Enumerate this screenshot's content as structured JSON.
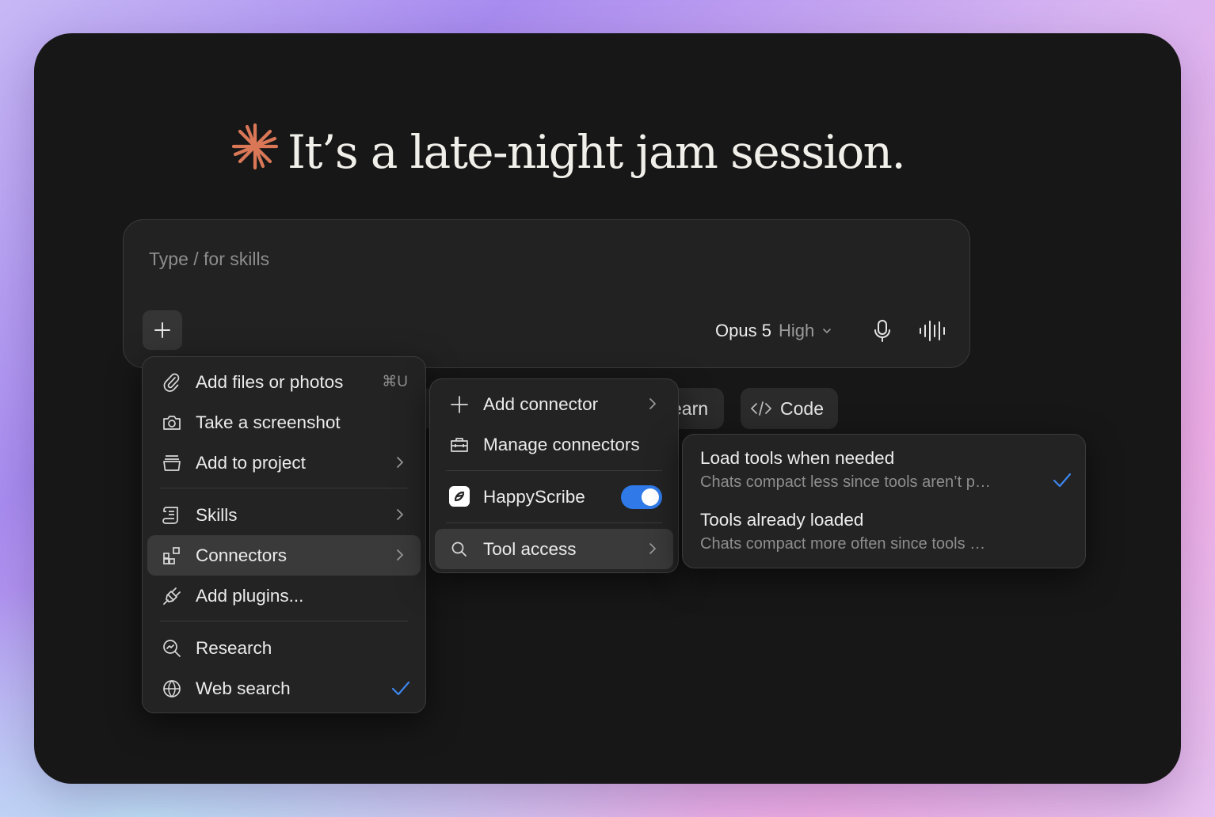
{
  "headline": {
    "text": "It’s a late-night jam session."
  },
  "composer": {
    "placeholder": "Type / for skills",
    "model_name": "Opus 5",
    "effort": "High"
  },
  "chips": {
    "learn_partial": "earn",
    "code": "Code"
  },
  "plus_menu": {
    "add_files": {
      "label": "Add files or photos",
      "shortcut": "⌘U"
    },
    "screenshot": "Take a screenshot",
    "add_project": "Add to project",
    "skills": "Skills",
    "connectors": "Connectors",
    "add_plugins": "Add plugins...",
    "research": "Research",
    "web_search": "Web search"
  },
  "connectors_menu": {
    "add_connector": "Add connector",
    "manage": "Manage connectors",
    "happyscribe": {
      "label": "HappyScribe",
      "enabled": true
    },
    "tool_access": "Tool access"
  },
  "tool_access_menu": {
    "options": [
      {
        "title": "Load tools when needed",
        "desc": "Chats compact less since tools aren’t p…",
        "selected": true
      },
      {
        "title": "Tools already loaded",
        "desc": "Chats compact more often since tools …",
        "selected": false
      }
    ]
  },
  "colors": {
    "accent_blue": "#2f7ae8",
    "brand_orange": "#d97757",
    "window_bg": "#171717"
  }
}
